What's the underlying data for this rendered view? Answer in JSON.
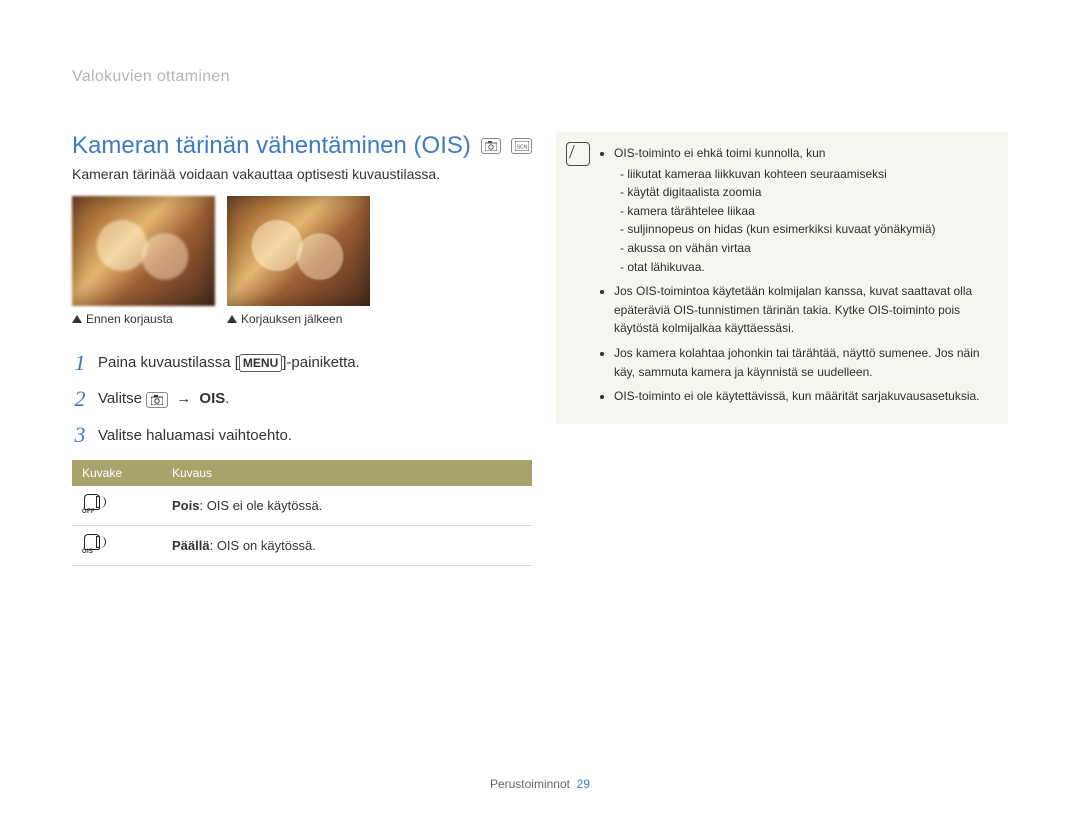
{
  "section_label": "Valokuvien ottaminen",
  "title": "Kameran tärinän vähentäminen (OIS)",
  "mode_icons": [
    "camera-icon",
    "scene-icon"
  ],
  "subtitle": "Kameran tärinää voidaan vakauttaa optisesti kuvaustilassa.",
  "captions": {
    "left": "Ennen korjausta",
    "right": "Korjauksen jälkeen"
  },
  "steps": {
    "s1_pre": "Paina kuvaustilassa [",
    "s1_menu": "MENU",
    "s1_post": "]-painiketta.",
    "s2_pre": "Valitse ",
    "s2_arrow": "→",
    "s2_target": "OIS",
    "s2_post": ".",
    "s3": "Valitse haluamasi vaihtoehto."
  },
  "table": {
    "headers": {
      "icon": "Kuvake",
      "desc": "Kuvaus"
    },
    "rows": [
      {
        "icon_tag": "OFF",
        "label": "Pois",
        "text": ": OIS ei ole käytössä."
      },
      {
        "icon_tag": "OIS",
        "label": "Päällä",
        "text": ": OIS on käytössä."
      }
    ]
  },
  "note": {
    "bullets": [
      {
        "text": "OIS-toiminto ei ehkä toimi kunnolla, kun",
        "sub": [
          "liikutat kameraa liikkuvan kohteen seuraamiseksi",
          "käytät digitaalista zoomia",
          "kamera tärähtelee liikaa",
          "suljinnopeus on hidas (kun esimerkiksi kuvaat yönäkymiä)",
          "akussa on vähän virtaa",
          "otat lähikuvaa."
        ]
      },
      {
        "text": "Jos OIS-toimintoa käytetään kolmijalan kanssa, kuvat saattavat olla epäteräviä OIS-tunnistimen tärinän takia. Kytke OIS-toiminto pois käytöstä kolmijalkaa käyttäessäsi."
      },
      {
        "text": "Jos kamera kolahtaa johonkin tai tärähtää, näyttö sumenee. Jos näin käy, sammuta kamera ja käynnistä se uudelleen."
      },
      {
        "text": "OIS-toiminto ei ole käytettävissä, kun määrität sarjakuvausasetuksia."
      }
    ]
  },
  "footer": {
    "label": "Perustoiminnot",
    "page": "29"
  }
}
